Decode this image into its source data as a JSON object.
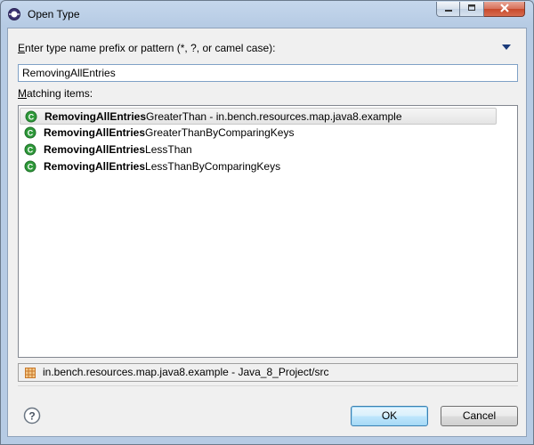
{
  "window": {
    "title": "Open Type"
  },
  "prompt": {
    "label_prefix": "Enter type name prefix or pattern (*, ?, or camel case):"
  },
  "search": {
    "value": "RemovingAllEntries"
  },
  "matching": {
    "label": "Matching items:"
  },
  "items": [
    {
      "bold": "RemovingAllEntries",
      "rest": "GreaterThan - in.bench.resources.map.java8.example"
    },
    {
      "bold": "RemovingAllEntries",
      "rest": "GreaterThanByComparingKeys"
    },
    {
      "bold": "RemovingAllEntries",
      "rest": "LessThan"
    },
    {
      "bold": "RemovingAllEntries",
      "rest": "LessThanByComparingKeys"
    }
  ],
  "status": {
    "text": "in.bench.resources.map.java8.example - Java_8_Project/src"
  },
  "buttons": {
    "ok": "OK",
    "cancel": "Cancel"
  },
  "colors": {
    "class_icon": "#2f9a3a",
    "package_icon": "#c9782a"
  }
}
